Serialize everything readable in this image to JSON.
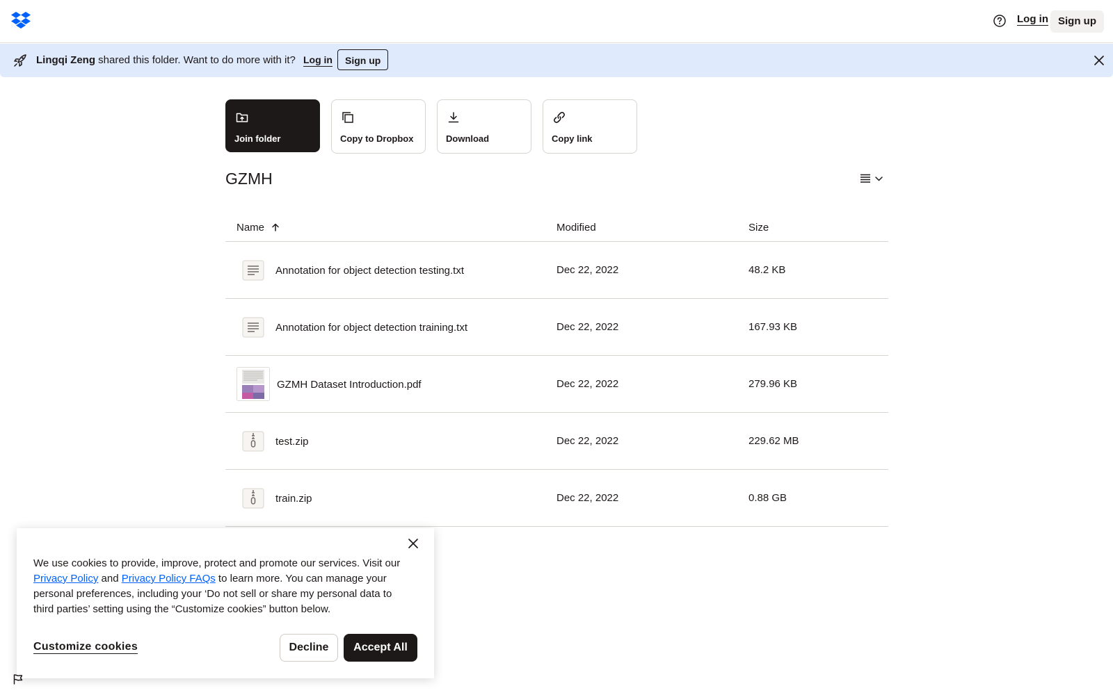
{
  "header": {
    "logo": "dropbox-logo",
    "help_icon": "help-circle-icon",
    "login_label": "Log in",
    "signup_label": "Sign up"
  },
  "banner": {
    "owner": "Lingqi Zeng",
    "message": "shared this folder. Want to do more with it?",
    "login_label": "Log in",
    "signup_label": "Sign up",
    "icon": "rocket-icon"
  },
  "actions": [
    {
      "label": "Join folder",
      "icon": "folder-upload-icon"
    },
    {
      "label": "Copy to Dropbox",
      "icon": "copy-icon"
    },
    {
      "label": "Download",
      "icon": "download-icon"
    },
    {
      "label": "Copy link",
      "icon": "link-icon"
    }
  ],
  "folder": {
    "title": "GZMH"
  },
  "table": {
    "columns": {
      "name": "Name",
      "modified": "Modified",
      "size": "Size"
    },
    "rows": [
      {
        "name": "Annotation for object detection testing.txt",
        "modified": "Dec 22, 2022",
        "size": "48.2 KB",
        "type": "txt"
      },
      {
        "name": "Annotation for object detection training.txt",
        "modified": "Dec 22, 2022",
        "size": "167.93 KB",
        "type": "txt"
      },
      {
        "name": "GZMH Dataset Introduction.pdf",
        "modified": "Dec 22, 2022",
        "size": "279.96 KB",
        "type": "pdf"
      },
      {
        "name": "test.zip",
        "modified": "Dec 22, 2022",
        "size": "229.62 MB",
        "type": "zip"
      },
      {
        "name": "train.zip",
        "modified": "Dec 22, 2022",
        "size": "0.88 GB",
        "type": "zip"
      }
    ]
  },
  "cookie": {
    "text_1": "We use cookies to provide, improve, protect and promote our services. Visit our ",
    "privacy_policy": "Privacy Policy",
    "and": " and ",
    "privacy_faqs": "Privacy Policy FAQs",
    "text_2": " to learn more. You can manage your personal preferences, including your ‘Do not sell or share my personal data to third parties’ setting using the “Customize cookies” button below.",
    "customize_label": "Customize cookies",
    "decline_label": "Decline",
    "accept_label": "Accept All"
  },
  "colors": {
    "text": "#1e1919",
    "banner_bg": "#dfeafd",
    "link": "#0061fe",
    "dropbox_blue": "#0061fe"
  }
}
